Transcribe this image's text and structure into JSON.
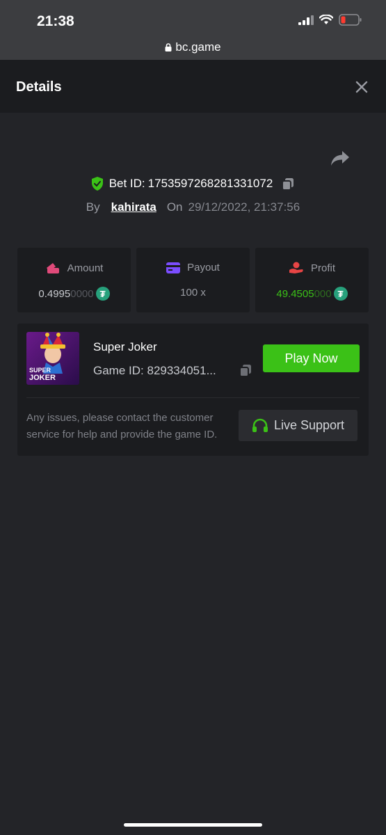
{
  "status_bar": {
    "time": "21:38",
    "url": "bc.game"
  },
  "header": {
    "title": "Details"
  },
  "bet": {
    "bet_id_label": "Bet ID:",
    "bet_id": "1753597268281331072",
    "by_label": "By",
    "username": "kahirata",
    "on_label": "On",
    "date": "29/12/2022, 21:37:56"
  },
  "stats": {
    "amount": {
      "label": "Amount",
      "value_main": "0.4995",
      "value_fade": "0000",
      "currency_icon": "tether-icon"
    },
    "payout": {
      "label": "Payout",
      "value": "100 x"
    },
    "profit": {
      "label": "Profit",
      "value_main": "49.4505",
      "value_fade": "000",
      "currency_icon": "tether-icon"
    }
  },
  "game": {
    "name": "Super Joker",
    "id_label": "Game ID:",
    "id_value": "829334051...",
    "thumb_text_1": "SUPER",
    "thumb_text_2": "JOKER",
    "play_label": "Play Now",
    "issue_text": "Any issues, please contact the customer service for help and provide the game ID.",
    "support_label": "Live Support"
  },
  "colors": {
    "background": "#232428",
    "panel": "#1b1c1f",
    "accent_green": "#3bc117",
    "amount_icon": "#e04a7a",
    "payout_icon": "#7b4dff",
    "profit_icon": "#e84545",
    "tether": "#27a17c"
  }
}
